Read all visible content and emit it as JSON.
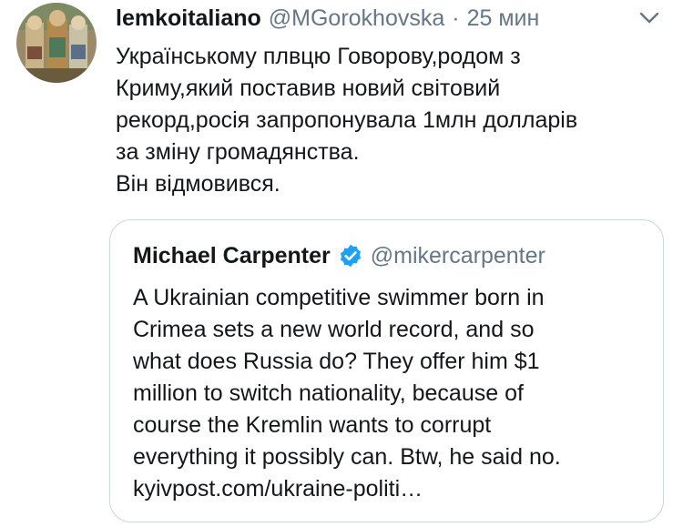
{
  "tweet": {
    "display_name": "lemkoitaliano",
    "handle": "@MGorokhovska",
    "separator": "·",
    "time": "25 мин",
    "text": "Українському плвцю Говорову,родом з\nКриму,який поставив новий світовий\nрекорд,росія запропонувала 1млн долларів\nза зміну громадянства.\nВін відмовився."
  },
  "quoted_tweet": {
    "display_name": "Michael Carpenter",
    "handle": "@mikercarpenter",
    "text": "A Ukrainian competitive swimmer born in\nCrimea sets a new world record, and so\nwhat does Russia do? They offer him $1\nmillion to switch nationality, because of\ncourse the Kremlin wants to corrupt\neverything it possibly can. Btw, he said no.\nkyivpost.com/ukraine-politi…"
  },
  "icons": {
    "menu": "chevron-down-icon",
    "verified": "verified-badge-icon"
  },
  "colors": {
    "text": "#14171a",
    "secondary": "#657786",
    "border": "#ccd6dd",
    "verified": "#1da1f2"
  }
}
